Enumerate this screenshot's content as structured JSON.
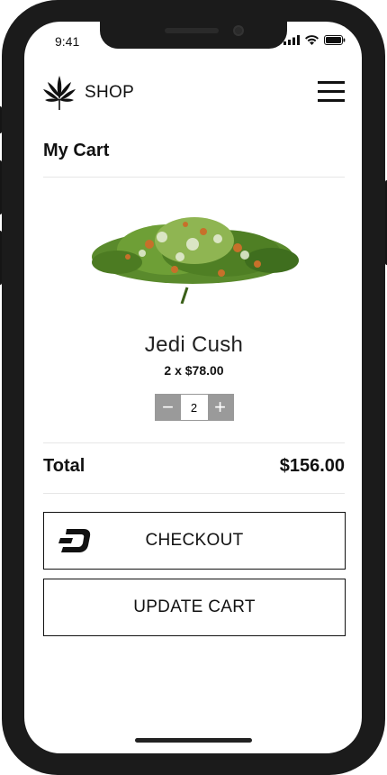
{
  "status": {
    "time": "9:41"
  },
  "header": {
    "brand": "SHOP"
  },
  "cart": {
    "title": "My Cart"
  },
  "product": {
    "name": "Jedi Cush",
    "price_line": "2 x $78.00",
    "quantity": "2"
  },
  "summary": {
    "total_label": "Total",
    "total_value": "$156.00"
  },
  "actions": {
    "checkout_label": "CHECKOUT",
    "update_label": "UPDATE CART"
  },
  "icons": [
    "cannabis-leaf-icon",
    "menu-icon",
    "dash-icon",
    "minus-icon",
    "plus-icon",
    "signal-icon",
    "wifi-icon",
    "battery-icon"
  ]
}
